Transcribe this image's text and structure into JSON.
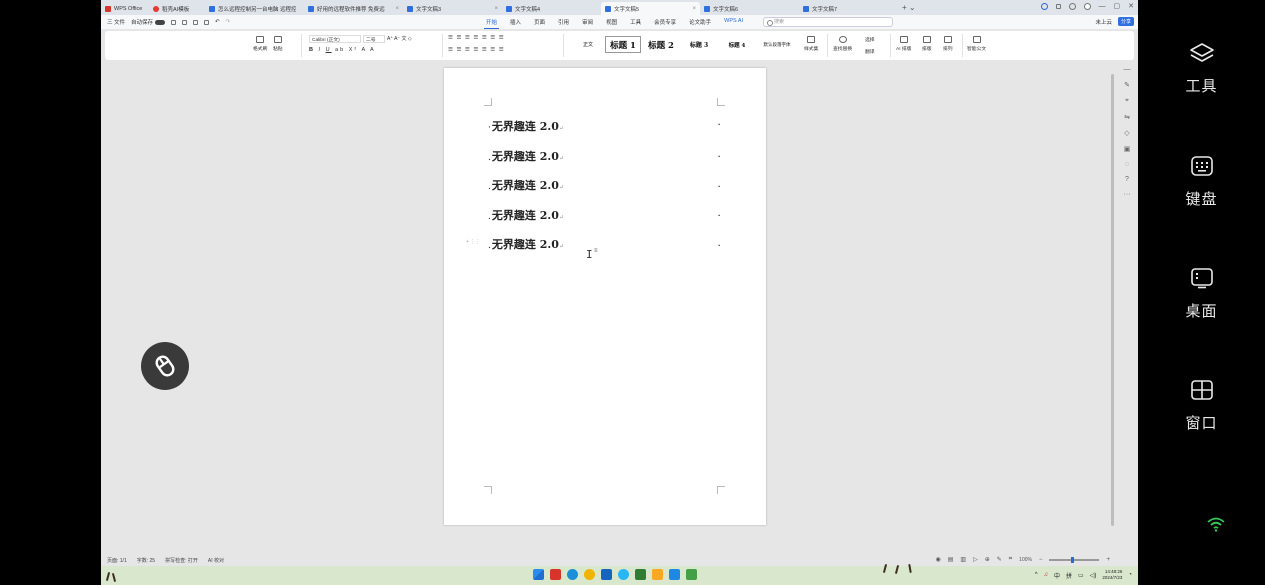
{
  "tabs": [
    {
      "label": "WPS Office",
      "icon": "wps-logo-icon",
      "active": false
    },
    {
      "label": "稻壳AI模板",
      "icon": "docer-icon",
      "active": false
    },
    {
      "label": "怎么远程控制另一台电脑 远程控制另一台电脑",
      "icon": "doc-icon",
      "active": false
    },
    {
      "label": "好用的远程软件推荐 免费远程控制",
      "icon": "doc-icon",
      "active": false
    },
    {
      "label": "文字文稿3",
      "icon": "doc-icon",
      "active": false
    },
    {
      "label": "文字文稿4",
      "icon": "doc-icon",
      "active": false
    },
    {
      "label": "文字文稿5",
      "icon": "doc-icon",
      "active": true
    },
    {
      "label": "文字文稿6",
      "icon": "doc-icon",
      "active": false
    },
    {
      "label": "文字文稿7",
      "icon": "doc-icon",
      "active": false
    }
  ],
  "menu": {
    "file": "三 文件",
    "autosave": "自动保存",
    "tabs": [
      "开始",
      "插入",
      "页面",
      "引用",
      "审阅",
      "视图",
      "工具",
      "会员专享",
      "论文助手",
      "WPS AI"
    ],
    "active_tab": "开始",
    "search_placeholder": "搜索",
    "upload": "未上云",
    "share": "分享"
  },
  "ribbon": {
    "format_painter": "格式刷",
    "paste": "粘贴",
    "font": "Calibri (正文)",
    "font_size": "二号",
    "styles": [
      "正文",
      "标题 1",
      "标题 2",
      "标题 3",
      "标题 4",
      "默认段落字体"
    ],
    "style_set": "样式集",
    "find_replace": "查找替换",
    "select": "选择",
    "translate": "翻译",
    "ai_layout": "AI 排版",
    "layout": "排版",
    "arrange": "排列",
    "smart_doc": "智能公文"
  },
  "document": {
    "paragraphs": [
      "无界趣连 2.0",
      "无界趣连 2.0",
      "无界趣连 2.0",
      "无界趣连 2.0",
      "无界趣连 2.0"
    ]
  },
  "status": {
    "page": "页面: 1/1",
    "words": "字数: 25",
    "spell": "拼写检查: 打开",
    "ai_check": "AI 校对",
    "zoom": "100%"
  },
  "taskbar": {
    "ime": "中",
    "layout": "拼",
    "time": "14:48:26",
    "date": "2024/7/23"
  },
  "side_panel": {
    "items": [
      {
        "label": "工具",
        "icon": "layers-icon"
      },
      {
        "label": "键盘",
        "icon": "keyboard-icon"
      },
      {
        "label": "桌面",
        "icon": "desktop-icon"
      },
      {
        "label": "窗口",
        "icon": "window-grid-icon"
      }
    ]
  },
  "colors": {
    "accent": "#2a6ad8",
    "wps_red": "#d9342b",
    "taskbar": "#d9e8cd",
    "wifi": "#34c759"
  }
}
